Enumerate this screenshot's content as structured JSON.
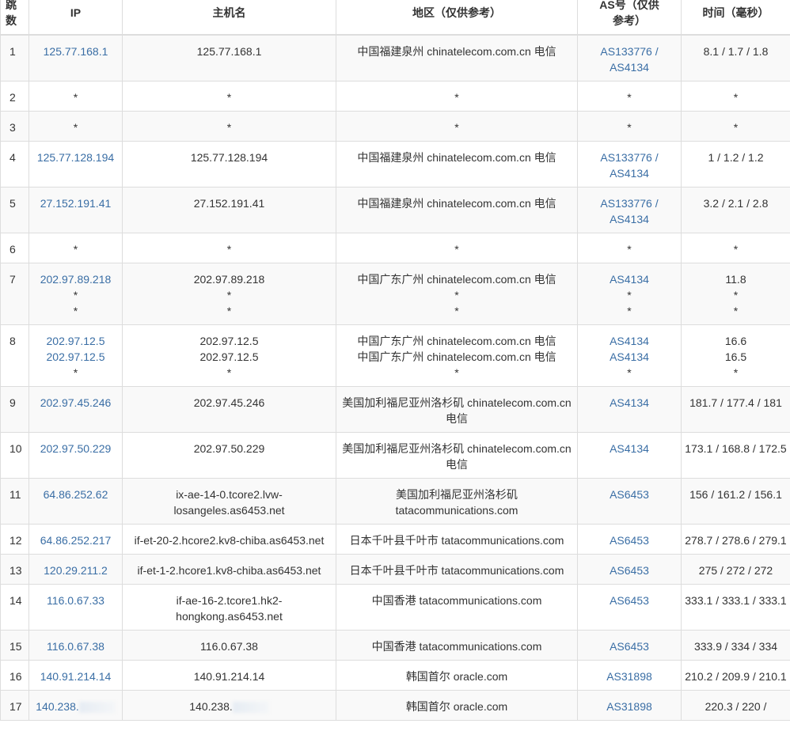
{
  "headers": {
    "hop": "跳数",
    "ip": "IP",
    "host": "主机名",
    "region": "地区（仅供参考）",
    "as": "AS号（仅供参考）",
    "time": "时间（毫秒）"
  },
  "rows": [
    {
      "hop": "1",
      "ip": [
        "125.77.168.1"
      ],
      "host": [
        "125.77.168.1"
      ],
      "region": [
        "中国福建泉州 chinatelecom.com.cn 电信"
      ],
      "as": [
        "AS133776 / AS4134"
      ],
      "time": [
        "8.1 / 1.7 / 1.8"
      ]
    },
    {
      "hop": "2",
      "ip": [
        "*"
      ],
      "host": [
        "*"
      ],
      "region": [
        "*"
      ],
      "as": [
        "*"
      ],
      "time": [
        "*"
      ]
    },
    {
      "hop": "3",
      "ip": [
        "*"
      ],
      "host": [
        "*"
      ],
      "region": [
        "*"
      ],
      "as": [
        "*"
      ],
      "time": [
        "*"
      ]
    },
    {
      "hop": "4",
      "ip": [
        "125.77.128.194"
      ],
      "host": [
        "125.77.128.194"
      ],
      "region": [
        "中国福建泉州 chinatelecom.com.cn 电信"
      ],
      "as": [
        "AS133776 / AS4134"
      ],
      "time": [
        "1 / 1.2 / 1.2"
      ]
    },
    {
      "hop": "5",
      "ip": [
        "27.152.191.41"
      ],
      "host": [
        "27.152.191.41"
      ],
      "region": [
        "中国福建泉州 chinatelecom.com.cn 电信"
      ],
      "as": [
        "AS133776 / AS4134"
      ],
      "time": [
        "3.2 / 2.1 / 2.8"
      ]
    },
    {
      "hop": "6",
      "ip": [
        "*"
      ],
      "host": [
        "*"
      ],
      "region": [
        "*"
      ],
      "as": [
        "*"
      ],
      "time": [
        "*"
      ]
    },
    {
      "hop": "7",
      "ip": [
        "202.97.89.218",
        "*",
        "*"
      ],
      "host": [
        "202.97.89.218",
        "*",
        "*"
      ],
      "region": [
        "中国广东广州 chinatelecom.com.cn 电信",
        "*",
        "*"
      ],
      "as": [
        "AS4134",
        "*",
        "*"
      ],
      "time": [
        "11.8",
        "*",
        "*"
      ]
    },
    {
      "hop": "8",
      "ip": [
        "202.97.12.5",
        "202.97.12.5",
        "*"
      ],
      "host": [
        "202.97.12.5",
        "202.97.12.5",
        "*"
      ],
      "region": [
        "中国广东广州 chinatelecom.com.cn 电信",
        "中国广东广州 chinatelecom.com.cn 电信",
        "*"
      ],
      "as": [
        "AS4134",
        "AS4134",
        "*"
      ],
      "time": [
        "16.6",
        "16.5",
        "*"
      ]
    },
    {
      "hop": "9",
      "ip": [
        "202.97.45.246"
      ],
      "host": [
        "202.97.45.246"
      ],
      "region": [
        "美国加利福尼亚州洛杉矶 chinatelecom.com.cn 电信"
      ],
      "as": [
        "AS4134"
      ],
      "time": [
        "181.7 / 177.4 / 181"
      ]
    },
    {
      "hop": "10",
      "ip": [
        "202.97.50.229"
      ],
      "host": [
        "202.97.50.229"
      ],
      "region": [
        "美国加利福尼亚州洛杉矶 chinatelecom.com.cn 电信"
      ],
      "as": [
        "AS4134"
      ],
      "time": [
        "173.1 / 168.8 / 172.5"
      ]
    },
    {
      "hop": "11",
      "ip": [
        "64.86.252.62"
      ],
      "host": [
        "ix-ae-14-0.tcore2.lvw-losangeles.as6453.net"
      ],
      "region": [
        "美国加利福尼亚州洛杉矶 tatacommunications.com"
      ],
      "as": [
        "AS6453"
      ],
      "time": [
        "156 / 161.2 / 156.1"
      ]
    },
    {
      "hop": "12",
      "ip": [
        "64.86.252.217"
      ],
      "host": [
        "if-et-20-2.hcore2.kv8-chiba.as6453.net"
      ],
      "region": [
        "日本千叶县千叶市 tatacommunications.com"
      ],
      "as": [
        "AS6453"
      ],
      "time": [
        "278.7 / 278.6 / 279.1"
      ]
    },
    {
      "hop": "13",
      "ip": [
        "120.29.211.2"
      ],
      "host": [
        "if-et-1-2.hcore1.kv8-chiba.as6453.net"
      ],
      "region": [
        "日本千叶县千叶市 tatacommunications.com"
      ],
      "as": [
        "AS6453"
      ],
      "time": [
        "275 / 272 / 272"
      ]
    },
    {
      "hop": "14",
      "ip": [
        "116.0.67.33"
      ],
      "host": [
        "if-ae-16-2.tcore1.hk2-hongkong.as6453.net"
      ],
      "region": [
        "中国香港 tatacommunications.com"
      ],
      "as": [
        "AS6453"
      ],
      "time": [
        "333.1 / 333.1 / 333.1"
      ]
    },
    {
      "hop": "15",
      "ip": [
        "116.0.67.38"
      ],
      "host": [
        "116.0.67.38"
      ],
      "region": [
        "中国香港 tatacommunications.com"
      ],
      "as": [
        "AS6453"
      ],
      "time": [
        "333.9 / 334 / 334"
      ]
    },
    {
      "hop": "16",
      "ip": [
        "140.91.214.14"
      ],
      "host": [
        "140.91.214.14"
      ],
      "region": [
        "韩国首尔 oracle.com"
      ],
      "as": [
        "AS31898"
      ],
      "time": [
        "210.2 / 209.9 / 210.1"
      ]
    },
    {
      "hop": "17",
      "ip": [
        "140.238."
      ],
      "host": [
        "140.238."
      ],
      "region": [
        "韩国首尔 oracle.com"
      ],
      "as": [
        "AS31898"
      ],
      "time": [
        "220.3 / 220 /"
      ],
      "redacted": true
    }
  ]
}
